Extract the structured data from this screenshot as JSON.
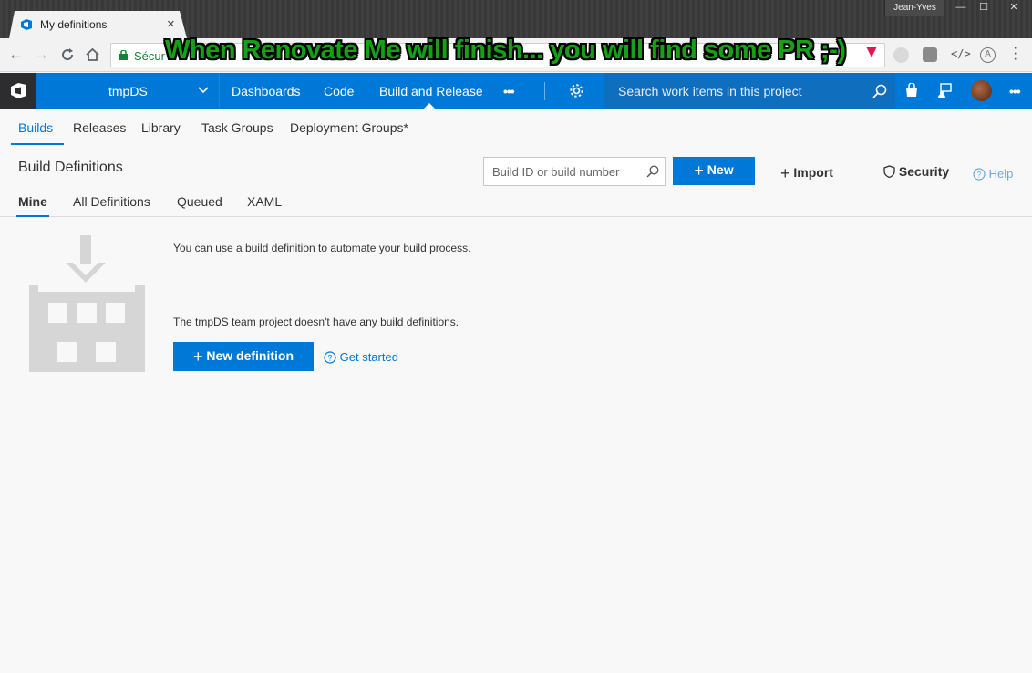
{
  "browser": {
    "tab_title": "My definitions",
    "tab_close": "×",
    "user_name": "Jean-Yves",
    "window_buttons": {
      "minimize": "—",
      "maximize": "☐",
      "close": "✕"
    },
    "security_label": "Sécur",
    "overlay_banner": "When Renovate Me will finish... you will find some PR ;-)"
  },
  "topnav": {
    "project": "tmpDS",
    "hubs": [
      "Dashboards",
      "Code",
      "Build and Release"
    ],
    "more": "•••",
    "search_placeholder": "Search work items in this project",
    "overflow": "•••"
  },
  "subnav": {
    "items": [
      "Builds",
      "Releases",
      "Library",
      "Task Groups",
      "Deployment Groups*"
    ]
  },
  "page": {
    "title": "Build Definitions",
    "search_placeholder": "Build ID or build number",
    "new_label": "New",
    "import_label": "Import",
    "security_label": "Security",
    "help_label": "Help",
    "tabs": [
      "Mine",
      "All Definitions",
      "Queued",
      "XAML"
    ]
  },
  "empty_state": {
    "line1": "You can use a build definition to automate your build process.",
    "line2": "The tmpDS team project doesn't have any build definitions.",
    "new_definition": "New definition",
    "get_started": "Get started"
  },
  "colors": {
    "accent": "#0078d7",
    "topbar": "#0078d7",
    "logo_bg": "#2d2d30",
    "banner_green": "#16a016"
  }
}
